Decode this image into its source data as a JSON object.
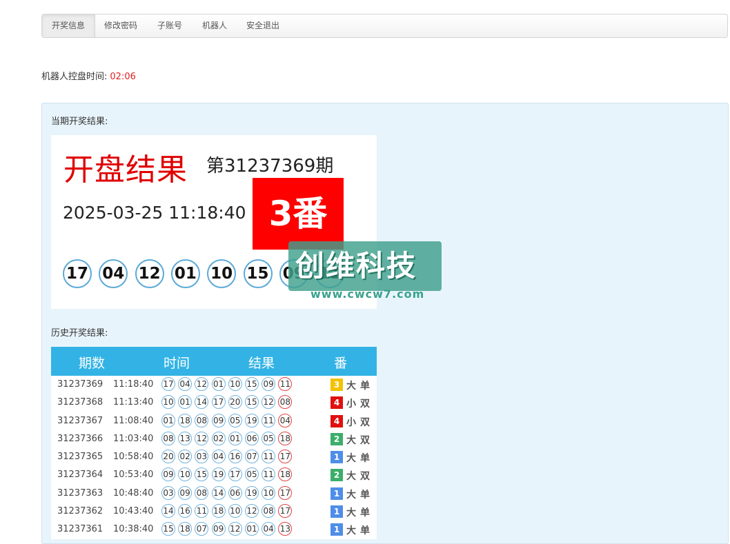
{
  "nav": {
    "tabs": [
      {
        "label": "开奖信息",
        "active": true
      },
      {
        "label": "修改密码",
        "active": false
      },
      {
        "label": "子账号",
        "active": false
      },
      {
        "label": "机器人",
        "active": false
      },
      {
        "label": "安全退出",
        "active": false
      }
    ]
  },
  "robot": {
    "label": "机器人控盘时间:",
    "time": "02:06"
  },
  "current": {
    "section_label": "当期开奖结果:",
    "title": "开盘结果",
    "period": "第31237369期",
    "datetime": "2025-03-25 11:18:40",
    "fan": "3番",
    "balls": [
      "17",
      "04",
      "12",
      "01",
      "10",
      "15",
      "09",
      "11"
    ]
  },
  "history": {
    "section_label": "历史开奖结果:",
    "headers": {
      "period": "期数",
      "time": "时间",
      "result": "结果",
      "fan": "番"
    },
    "rows": [
      {
        "period": "31237369",
        "time": "11:18:40",
        "balls": [
          "17",
          "04",
          "12",
          "01",
          "10",
          "15",
          "09",
          "11"
        ],
        "fan": "3",
        "size": "大",
        "parity": "单",
        "fan_color": "#f2c200"
      },
      {
        "period": "31237368",
        "time": "11:13:40",
        "balls": [
          "10",
          "01",
          "14",
          "17",
          "20",
          "15",
          "12",
          "08"
        ],
        "fan": "4",
        "size": "小",
        "parity": "双",
        "fan_color": "#e01010"
      },
      {
        "period": "31237367",
        "time": "11:08:40",
        "balls": [
          "01",
          "18",
          "08",
          "09",
          "05",
          "19",
          "11",
          "04"
        ],
        "fan": "4",
        "size": "小",
        "parity": "双",
        "fan_color": "#e01010"
      },
      {
        "period": "31237366",
        "time": "11:03:40",
        "balls": [
          "08",
          "13",
          "12",
          "02",
          "01",
          "06",
          "05",
          "18"
        ],
        "fan": "2",
        "size": "大",
        "parity": "双",
        "fan_color": "#3cae6a"
      },
      {
        "period": "31237365",
        "time": "10:58:40",
        "balls": [
          "20",
          "02",
          "03",
          "04",
          "16",
          "07",
          "11",
          "17"
        ],
        "fan": "1",
        "size": "大",
        "parity": "单",
        "fan_color": "#4f8ee8"
      },
      {
        "period": "31237364",
        "time": "10:53:40",
        "balls": [
          "09",
          "10",
          "15",
          "19",
          "17",
          "05",
          "11",
          "18"
        ],
        "fan": "2",
        "size": "大",
        "parity": "双",
        "fan_color": "#3cae6a"
      },
      {
        "period": "31237363",
        "time": "10:48:40",
        "balls": [
          "03",
          "09",
          "08",
          "14",
          "06",
          "19",
          "10",
          "17"
        ],
        "fan": "1",
        "size": "大",
        "parity": "单",
        "fan_color": "#4f8ee8"
      },
      {
        "period": "31237362",
        "time": "10:43:40",
        "balls": [
          "14",
          "16",
          "11",
          "18",
          "10",
          "12",
          "08",
          "17"
        ],
        "fan": "1",
        "size": "大",
        "parity": "单",
        "fan_color": "#4f8ee8"
      },
      {
        "period": "31237361",
        "time": "10:38:40",
        "balls": [
          "15",
          "18",
          "07",
          "09",
          "12",
          "01",
          "04",
          "13"
        ],
        "fan": "1",
        "size": "大",
        "parity": "单",
        "fan_color": "#4f8ee8"
      }
    ]
  },
  "watermark": {
    "text": "创维科技",
    "url": "www.cwcw7.com"
  }
}
